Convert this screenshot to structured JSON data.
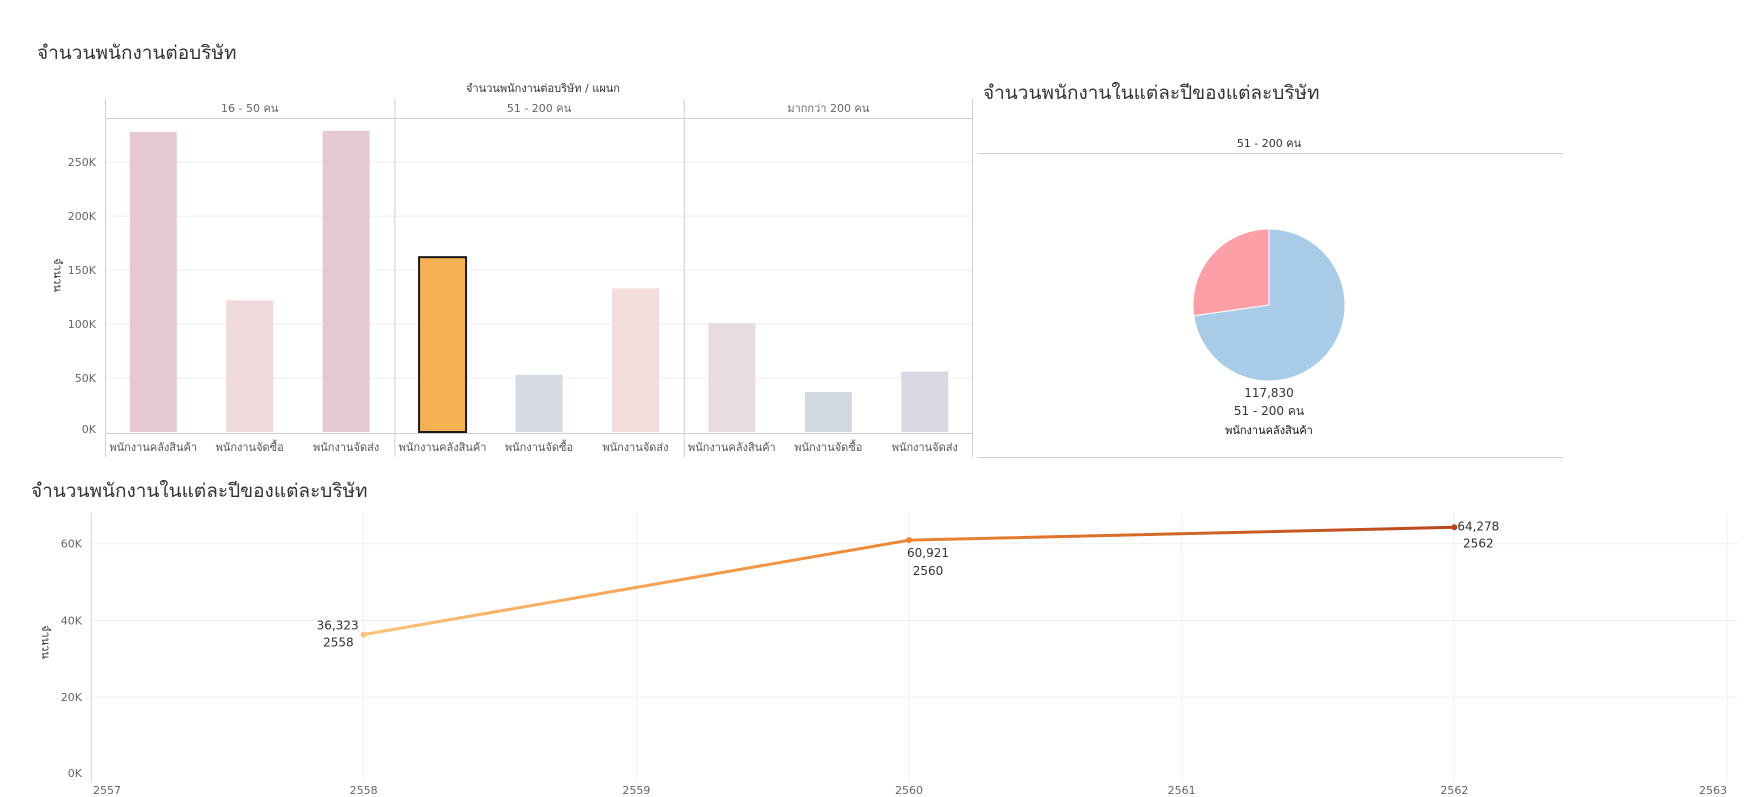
{
  "dashboard": {
    "title1": "จำนวนพนักงานต่อบริษัท",
    "title2": "จำนวนพนักงานในแต่ละปีของแต่ละบริษัท",
    "title3": "จำนวนพนักงานในแต่ละปีของแต่ละบริษัท"
  },
  "chart_data": [
    {
      "type": "bar",
      "title": "จำนวนพนักงานต่อบริษัท / แผนก",
      "ylabel": "จำนวน",
      "ylim": [
        0,
        290000
      ],
      "yticks": [
        0,
        50000,
        100000,
        150000,
        200000,
        250000
      ],
      "ytick_labels": [
        "0K",
        "50K",
        "100K",
        "150K",
        "200K",
        "250K"
      ],
      "grid": true,
      "highlight": {
        "panel": 1,
        "category": 0
      },
      "panels": [
        {
          "label": "16 - 50 คน",
          "categories": [
            "พนักงานคลังสินค้า",
            "พนักงานจัดซื้อ",
            "พนักงานจัดส่ง"
          ],
          "values": [
            278000,
            122000,
            279000
          ],
          "colors": [
            "#e6c8d0",
            "#f0dade",
            "#e6c8d0"
          ]
        },
        {
          "label": "51 - 200 คน",
          "categories": [
            "พนักงานคลังสินค้า",
            "พนักงานจัดซื้อ",
            "พนักงานจัดส่ง"
          ],
          "values": [
            162000,
            53000,
            133000
          ],
          "colors": [
            "#f4b254",
            "#d6dae2",
            "#f2dcdc"
          ]
        },
        {
          "label": "มากกว่า 200 คน",
          "categories": [
            "พนักงานคลังสินค้า",
            "พนักงานจัดซื้อ",
            "พนักงานจัดส่ง"
          ],
          "values": [
            101000,
            37000,
            56000
          ],
          "colors": [
            "#e8dbe2",
            "#d3d9e1",
            "#d9d9e3"
          ]
        }
      ]
    },
    {
      "type": "pie",
      "header": "51 - 200 คน",
      "slices": [
        {
          "value": 117830,
          "color": "#a8cce7"
        },
        {
          "value": 44170,
          "color": "#fd9fa6"
        }
      ],
      "label_value": "117,830",
      "label_group": "51 - 200 คน",
      "label_category": "พนักงานคลังสินค้า"
    },
    {
      "type": "line",
      "ylabel": "จำนวน",
      "xlim": [
        2557,
        2563
      ],
      "xticks": [
        "2557",
        "2558",
        "2559",
        "2560",
        "2561",
        "2562",
        "2563"
      ],
      "ylim": [
        0,
        68000
      ],
      "yticks": [
        0,
        20000,
        40000,
        60000
      ],
      "ytick_labels": [
        "0K",
        "20K",
        "40K",
        "60K"
      ],
      "grid": true,
      "series": [
        {
          "points": [
            {
              "x": 2558,
              "y": 36323,
              "label_value": "36,323",
              "label_year": "2558"
            },
            {
              "x": 2560,
              "y": 60921,
              "label_value": "60,921",
              "label_year": "2560"
            },
            {
              "x": 2562,
              "y": 64278,
              "label_value": "64,278",
              "label_year": "2562"
            }
          ],
          "gradient": [
            "#fcc378",
            "#ee8532",
            "#b7461c"
          ]
        }
      ]
    }
  ]
}
